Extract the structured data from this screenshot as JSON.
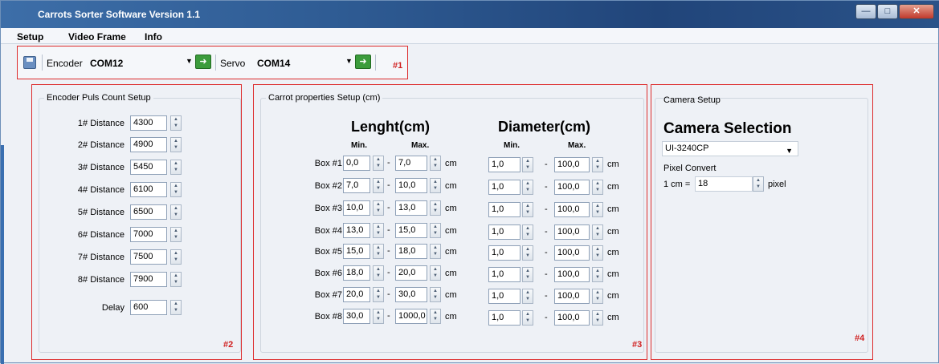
{
  "window": {
    "title": "Carrots Sorter Software Version 1.1"
  },
  "menu": [
    "Setup",
    "Video Frame",
    "Info"
  ],
  "toolbar": {
    "encoder_label": "Encoder",
    "encoder_port": "COM12",
    "servo_label": "Servo",
    "servo_port": "COM14",
    "marker": "#1"
  },
  "encoder_panel": {
    "title": "Encoder Puls Count Setup",
    "marker": "#2",
    "distances": [
      {
        "label": "1# Distance",
        "value": "4300"
      },
      {
        "label": "2# Distance",
        "value": "4900"
      },
      {
        "label": "3# Distance",
        "value": "5450"
      },
      {
        "label": "4# Distance",
        "value": "6100"
      },
      {
        "label": "5# Distance",
        "value": "6500"
      },
      {
        "label": "6# Distance",
        "value": "7000"
      },
      {
        "label": "7# Distance",
        "value": "7500"
      },
      {
        "label": "8# Distance",
        "value": "7900"
      }
    ],
    "delay": {
      "label": "Delay",
      "value": "600"
    }
  },
  "carrot_panel": {
    "title": "Carrot properties Setup (cm)",
    "marker": "#3",
    "length_title": "Lenght(cm)",
    "diameter_title": "Diameter(cm)",
    "min_label": "Min.",
    "max_label": "Max.",
    "unit": "cm",
    "dash": "-",
    "boxes": [
      {
        "label": "Box #1",
        "len_min": "0,0",
        "len_max": "7,0",
        "dia_min": "1,0",
        "dia_max": "100,0"
      },
      {
        "label": "Box #2",
        "len_min": "7,0",
        "len_max": "10,0",
        "dia_min": "1,0",
        "dia_max": "100,0"
      },
      {
        "label": "Box #3",
        "len_min": "10,0",
        "len_max": "13,0",
        "dia_min": "1,0",
        "dia_max": "100,0"
      },
      {
        "label": "Box #4",
        "len_min": "13,0",
        "len_max": "15,0",
        "dia_min": "1,0",
        "dia_max": "100,0"
      },
      {
        "label": "Box #5",
        "len_min": "15,0",
        "len_max": "18,0",
        "dia_min": "1,0",
        "dia_max": "100,0"
      },
      {
        "label": "Box #6",
        "len_min": "18,0",
        "len_max": "20,0",
        "dia_min": "1,0",
        "dia_max": "100,0"
      },
      {
        "label": "Box #7",
        "len_min": "20,0",
        "len_max": "30,0",
        "dia_min": "1,0",
        "dia_max": "100,0"
      },
      {
        "label": "Box #8",
        "len_min": "30,0",
        "len_max": "1000,0",
        "dia_min": "1,0",
        "dia_max": "100,0"
      }
    ]
  },
  "camera_panel": {
    "title": "Camera Setup",
    "marker": "#4",
    "selection_title": "Camera Selection",
    "camera": "UI-3240CP",
    "pixel_convert_label": "Pixel Convert",
    "cm_label": "1 cm =",
    "pixel_value": "18",
    "pixel_unit": "pixel"
  }
}
